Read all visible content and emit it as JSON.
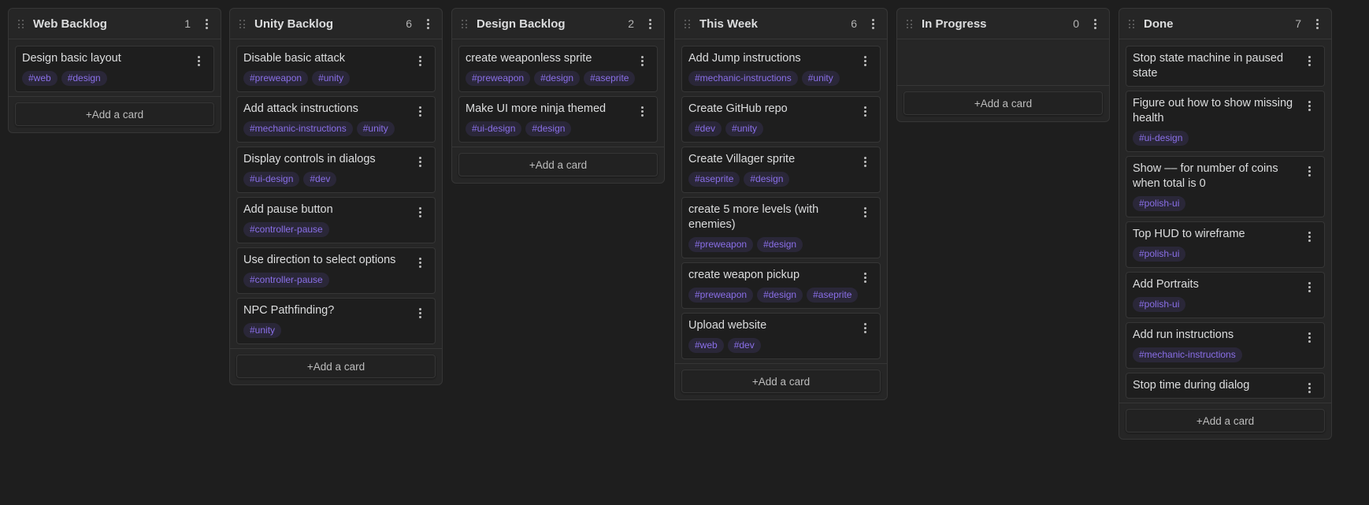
{
  "lanes": [
    {
      "title": "Web Backlog",
      "count": "1",
      "cards": [
        {
          "title": "Design basic layout",
          "tags": [
            "#web",
            "#design"
          ]
        }
      ],
      "add_label": "+Add a card"
    },
    {
      "title": "Unity Backlog",
      "count": "6",
      "cards": [
        {
          "title": "Disable basic attack",
          "tags": [
            "#preweapon",
            "#unity"
          ]
        },
        {
          "title": "Add attack instructions",
          "tags": [
            "#mechanic-instructions",
            "#unity"
          ]
        },
        {
          "title": "Display controls in dialogs",
          "tags": [
            "#ui-design",
            "#dev"
          ]
        },
        {
          "title": "Add pause button",
          "tags": [
            "#controller-pause"
          ]
        },
        {
          "title": "Use direction to select options",
          "tags": [
            "#controller-pause"
          ]
        },
        {
          "title": "NPC Pathfinding?",
          "tags": [
            "#unity"
          ]
        }
      ],
      "add_label": "+Add a card"
    },
    {
      "title": "Design Backlog",
      "count": "2",
      "cards": [
        {
          "title": "create weaponless sprite",
          "tags": [
            "#preweapon",
            "#design",
            "#aseprite"
          ]
        },
        {
          "title": "Make UI more ninja themed",
          "tags": [
            "#ui-design",
            "#design"
          ]
        }
      ],
      "add_label": "+Add a card"
    },
    {
      "title": "This Week",
      "count": "6",
      "cards": [
        {
          "title": "Add Jump instructions",
          "tags": [
            "#mechanic-instructions",
            "#unity"
          ]
        },
        {
          "title": "Create GitHub repo",
          "tags": [
            "#dev",
            "#unity"
          ]
        },
        {
          "title": "Create Villager sprite",
          "tags": [
            "#aseprite",
            "#design"
          ]
        },
        {
          "title": "create 5 more levels (with enemies)",
          "tags": [
            "#preweapon",
            "#design"
          ]
        },
        {
          "title": "create weapon pickup",
          "tags": [
            "#preweapon",
            "#design",
            "#aseprite"
          ]
        },
        {
          "title": "Upload website",
          "tags": [
            "#web",
            "#dev"
          ]
        }
      ],
      "add_label": "+Add a card"
    },
    {
      "title": "In Progress",
      "count": "0",
      "cards": [],
      "add_label": "+Add a card"
    },
    {
      "title": "Done",
      "count": "7",
      "cards": [
        {
          "title": "Stop state machine in paused state",
          "tags": []
        },
        {
          "title": "Figure out how to show missing health",
          "tags": [
            "#ui-design"
          ]
        },
        {
          "title": "Show –– for number of coins when total is 0",
          "tags": [
            "#polish-ui"
          ]
        },
        {
          "title": "Top HUD to wireframe",
          "tags": [
            "#polish-ui"
          ]
        },
        {
          "title": "Add Portraits",
          "tags": [
            "#polish-ui"
          ]
        },
        {
          "title": "Add run instructions",
          "tags": [
            "#mechanic-instructions"
          ]
        },
        {
          "title": "Stop time during dialog",
          "tags": []
        }
      ],
      "add_label": "+Add a card"
    }
  ],
  "colors": {
    "background": "#1e1e1e",
    "lane": "#262626",
    "tag_bg": "#2a2738",
    "tag_text": "#8a6fe8"
  },
  "icons": {
    "drag_handle": "grip-vertical-icon",
    "menu": "more-vertical-icon"
  }
}
